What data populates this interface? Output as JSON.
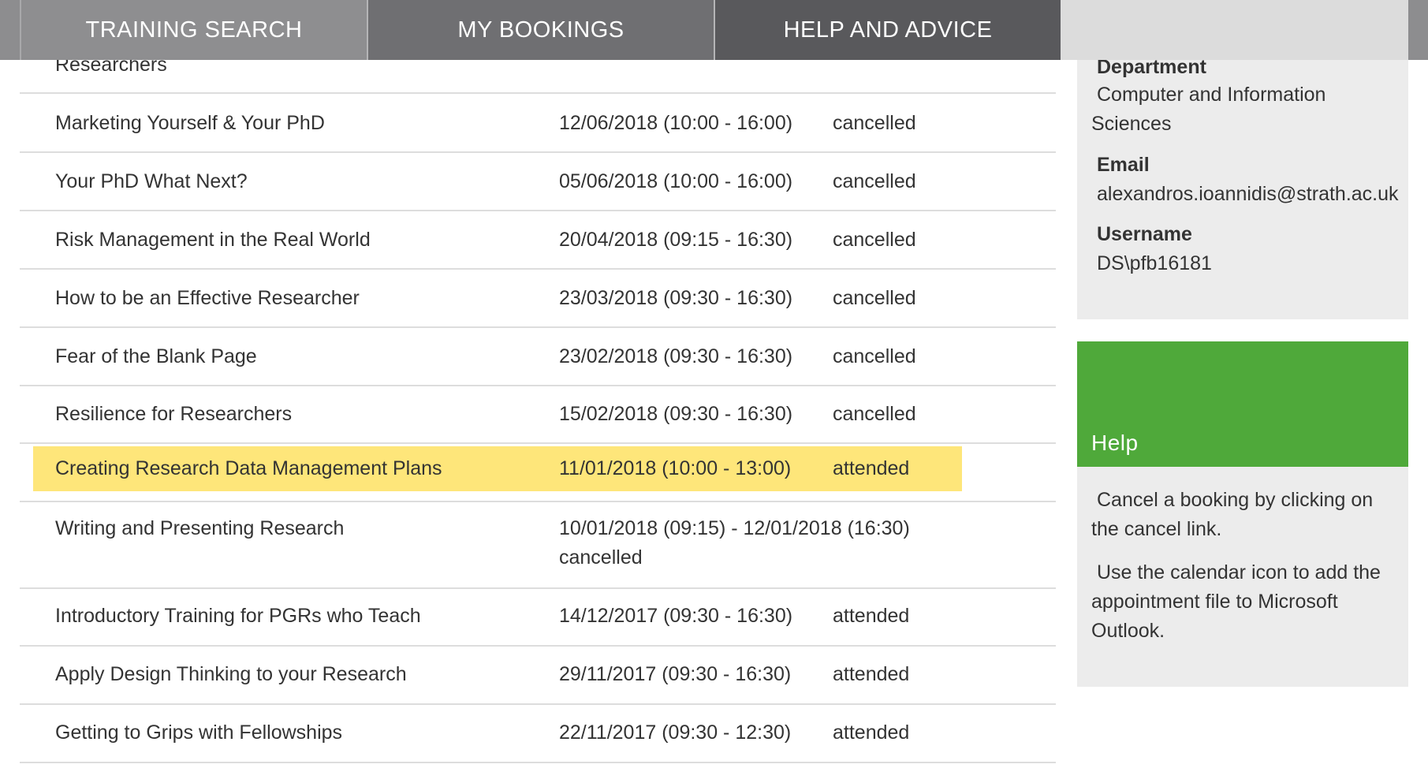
{
  "nav": {
    "tabs": [
      {
        "label": "TRAINING SEARCH"
      },
      {
        "label": "MY BOOKINGS"
      },
      {
        "label": "HELP AND ADVICE"
      }
    ]
  },
  "bookings": {
    "rows": [
      {
        "course": "Researchers",
        "date": "",
        "status": ""
      },
      {
        "course": "Marketing Yourself & Your PhD",
        "date": "12/06/2018 (10:00 - 16:00)",
        "status": "cancelled"
      },
      {
        "course": "Your PhD What Next?",
        "date": "05/06/2018 (10:00 - 16:00)",
        "status": "cancelled"
      },
      {
        "course": "Risk Management in the Real World",
        "date": "20/04/2018 (09:15 - 16:30)",
        "status": "cancelled"
      },
      {
        "course": "How to be an Effective Researcher",
        "date": "23/03/2018 (09:30 - 16:30)",
        "status": "cancelled"
      },
      {
        "course": "Fear of the Blank Page",
        "date": "23/02/2018 (09:30 - 16:30)",
        "status": "cancelled"
      },
      {
        "course": "Resilience for Researchers",
        "date": "15/02/2018 (09:30 - 16:30)",
        "status": "cancelled"
      },
      {
        "course": "Creating Research Data Management Plans",
        "date": "11/01/2018 (10:00 - 13:00)",
        "status": "attended"
      },
      {
        "course": "Writing and Presenting Research",
        "date": "10/01/2018 (09:15) - 12/01/2018 (16:30)",
        "status": "cancelled"
      },
      {
        "course": "Introductory Training for PGRs who Teach",
        "date": "14/12/2017 (09:30 - 16:30)",
        "status": "attended"
      },
      {
        "course": "Apply Design Thinking to your Research",
        "date": "29/11/2017 (09:30 - 16:30)",
        "status": "attended"
      },
      {
        "course": "Getting to Grips with Fellowships",
        "date": "22/11/2017 (09:30 - 12:30)",
        "status": "attended"
      }
    ]
  },
  "profile": {
    "department_label": "Department",
    "department_value": "Computer and Information Sciences",
    "email_label": "Email",
    "email_value": "alexandros.ioannidis@strath.ac.uk",
    "username_label": "Username",
    "username_value": "DS\\pfb16181"
  },
  "help": {
    "title": "Help",
    "text1": "Cancel a booking by clicking on the cancel link.",
    "text2": "Use the calendar icon to add the appointment file to Microsoft Outlook."
  },
  "colors": {
    "highlight": "#fee67a",
    "help_green": "#4fa93a",
    "nav_dark": "#59595c",
    "nav_mid": "#6f6f72",
    "nav_light": "#8e8e90"
  }
}
